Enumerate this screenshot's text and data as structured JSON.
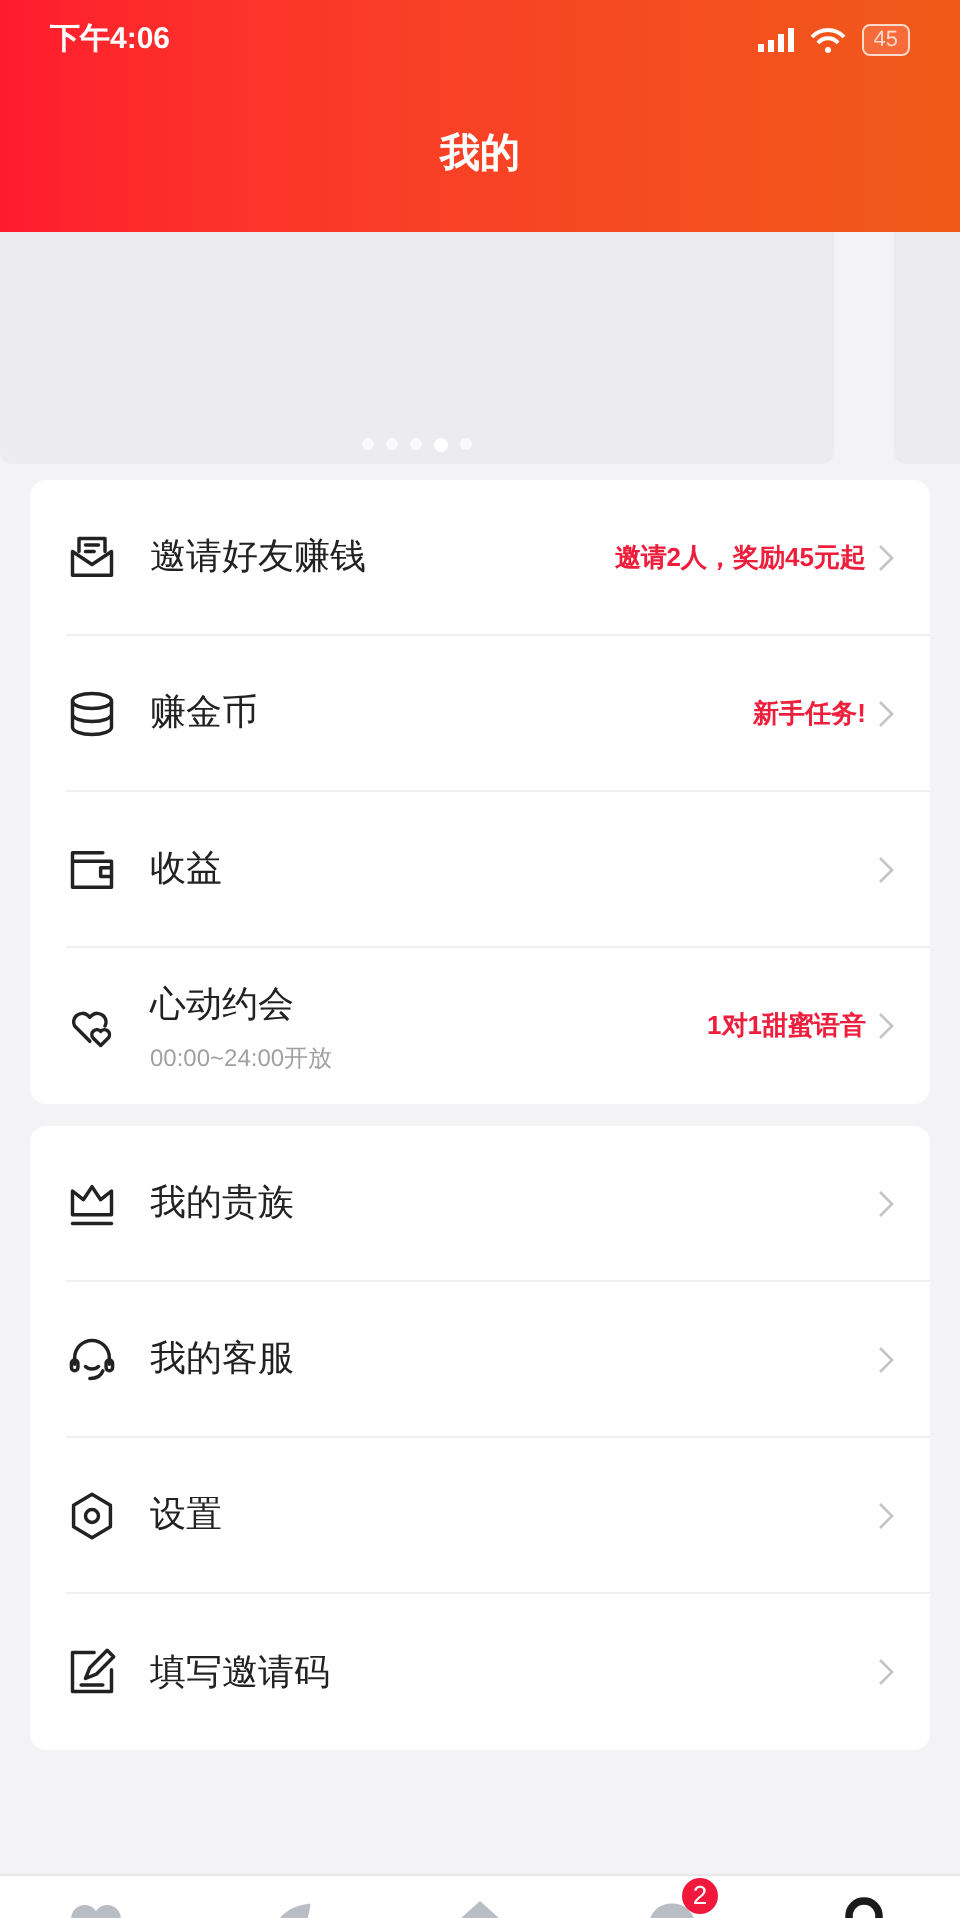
{
  "status_bar": {
    "time": "下午4:06",
    "battery": "45"
  },
  "header": {
    "title": "我的"
  },
  "banner": {
    "dots": [
      {
        "selected": false
      },
      {
        "selected": false
      },
      {
        "selected": false
      },
      {
        "selected": true
      },
      {
        "selected": false
      }
    ]
  },
  "menu_groups": [
    {
      "items": [
        {
          "label": "邀请好友赚钱",
          "note": "邀请2人，奖励45元起"
        },
        {
          "label": "赚金币",
          "note": "新手任务!"
        },
        {
          "label": "收益"
        },
        {
          "label": "心动约会",
          "sublabel": "00:00~24:00开放",
          "note": "1对1甜蜜语音"
        }
      ]
    },
    {
      "items": [
        {
          "label": "我的贵族"
        },
        {
          "label": "我的客服"
        },
        {
          "label": "设置"
        },
        {
          "label": "填写邀请码"
        }
      ]
    }
  ],
  "tab_bar": {
    "tabs": [
      {
        "selected": false
      },
      {
        "selected": false
      },
      {
        "selected": false
      },
      {
        "selected": false,
        "badge": "2"
      },
      {
        "selected": true
      }
    ]
  }
}
